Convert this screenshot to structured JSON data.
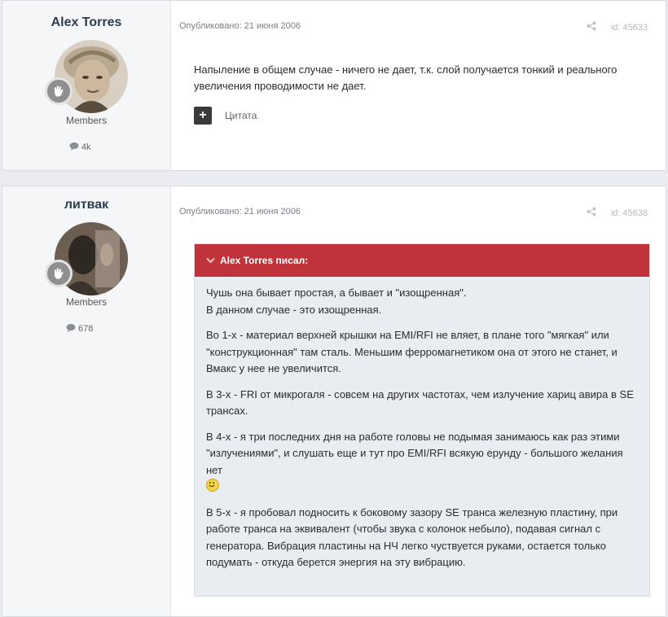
{
  "posts": [
    {
      "author": "Alex Torres",
      "group": "Members",
      "post_count": "4k",
      "published": "Опубликовано: 21 июня 2006",
      "post_id": "id: 45633",
      "text": "Напыление в общем случае - ничего не дает, т.к. слой получается тонкий и реального увеличения проводимости не дает.",
      "quote_button_label": "+",
      "quote_label": "Цитата"
    },
    {
      "author": "литвак",
      "group": "Members",
      "post_count": "678",
      "published": "Опубликовано: 21 июня 2006",
      "post_id": "id: 45638",
      "quote": {
        "header": "Alex Torres писал:",
        "paragraphs": [
          "Чушь она бывает простая, а бывает и \"изощренная\".\nВ данном случае - это изощренная.",
          "Во 1-х - материал верхней крышки на EMI/RFI не вляет, в плане того \"мягкая\" или \"конструкционная\" там сталь. Меньшим ферромагнетиком она от этого не станет, и Вмакс у нее не увеличится.",
          "В 3-х - FRI от микрогаля - совсем на других частотах, чем излучение хариц авира в SE трансах.",
          "В 4-х - я три последних дня на работе головы не подымая занимаюсь как раз этими \"излучениями\", и слушать еще и тут про EMI/RFI всякую ерунду - большого желания нет",
          "В 5-х - я пробовал подносить к боковому зазору SE транса железную пластину, при работе транса на эквивалент (чтобы звука с колонок небыло), подавая сигнал с генератора. Вибрация пластины на НЧ легко чуствуется руками, остается только подумать - откуда берется энергия на эту вибрацию."
        ]
      }
    }
  ],
  "icons": {
    "share": "share-icon",
    "comment": "comment-icon",
    "rank": "rank-badge-icon",
    "chevron": "chevron-down-icon",
    "smiley": "smiley-icon"
  },
  "colors": {
    "quote_header": "#c1333a",
    "quote_bg": "#e9ecf1",
    "author_panel": "#f5f6f8",
    "page_bg": "#ebecf1"
  }
}
